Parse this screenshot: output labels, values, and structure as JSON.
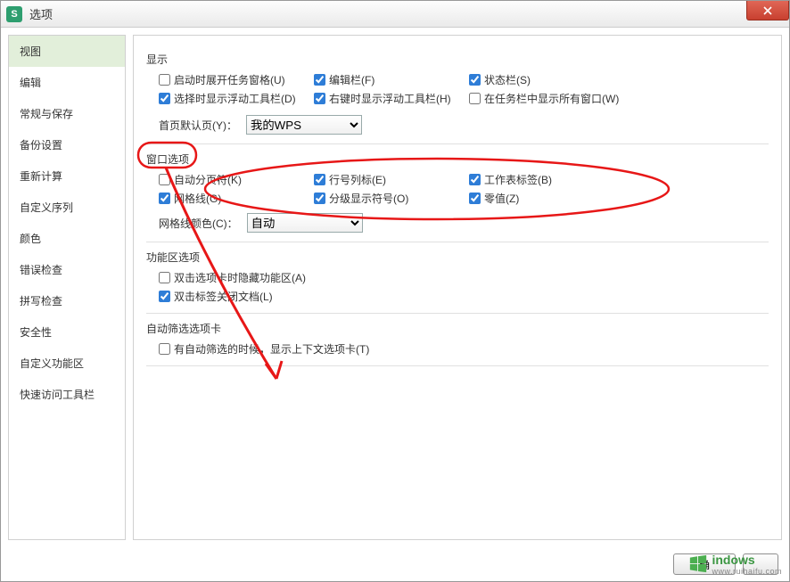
{
  "titlebar": {
    "title": "选项"
  },
  "sidebar": {
    "items": [
      {
        "label": "视图",
        "active": true
      },
      {
        "label": "编辑"
      },
      {
        "label": "常规与保存"
      },
      {
        "label": "备份设置"
      },
      {
        "label": "重新计算"
      },
      {
        "label": "自定义序列"
      },
      {
        "label": "颜色"
      },
      {
        "label": "错误检查"
      },
      {
        "label": "拼写检查"
      },
      {
        "label": "安全性"
      },
      {
        "label": "自定义功能区"
      },
      {
        "label": "快速访问工具栏"
      }
    ]
  },
  "sections": {
    "display": {
      "title": "显示",
      "opts": {
        "startup_open_task_pane": "启动时展开任务窗格(U)",
        "formula_bar": "编辑栏(F)",
        "status_bar": "状态栏(S)",
        "show_float_toolbar_on_select": "选择时显示浮动工具栏(D)",
        "show_float_toolbar_right_click": "右键时显示浮动工具栏(H)",
        "show_all_windows_in_taskbar": "在任务栏中显示所有窗口(W)"
      },
      "home_label": "首页默认页(Y)：",
      "home_value": "我的WPS"
    },
    "window": {
      "title": "窗口选项",
      "opts": {
        "auto_page_break": "自动分页符(K)",
        "row_col_header": "行号列标(E)",
        "sheet_tabs": "工作表标签(B)",
        "gridlines": "网格线(G)",
        "outline_symbols": "分级显示符号(O)",
        "zero_values": "零值(Z)"
      },
      "grid_color_label": "网格线颜色(C)：",
      "grid_color_value": "自动"
    },
    "ribbon": {
      "title": "功能区选项",
      "opts": {
        "dblclick_tab_hide_ribbon": "双击选项卡时隐藏功能区(A)",
        "dblclick_tab_close_doc": "双击标签关闭文档(L)"
      }
    },
    "filter": {
      "title": "自动筛选选项卡",
      "opts": {
        "show_context_when_autofilter": "有自动筛选的时候，显示上下文选项卡(T)"
      }
    }
  },
  "footer": {
    "ok": "确",
    "cancel": ""
  },
  "watermark": {
    "brand": "indows",
    "sub": "www.ruihaifu.com"
  }
}
